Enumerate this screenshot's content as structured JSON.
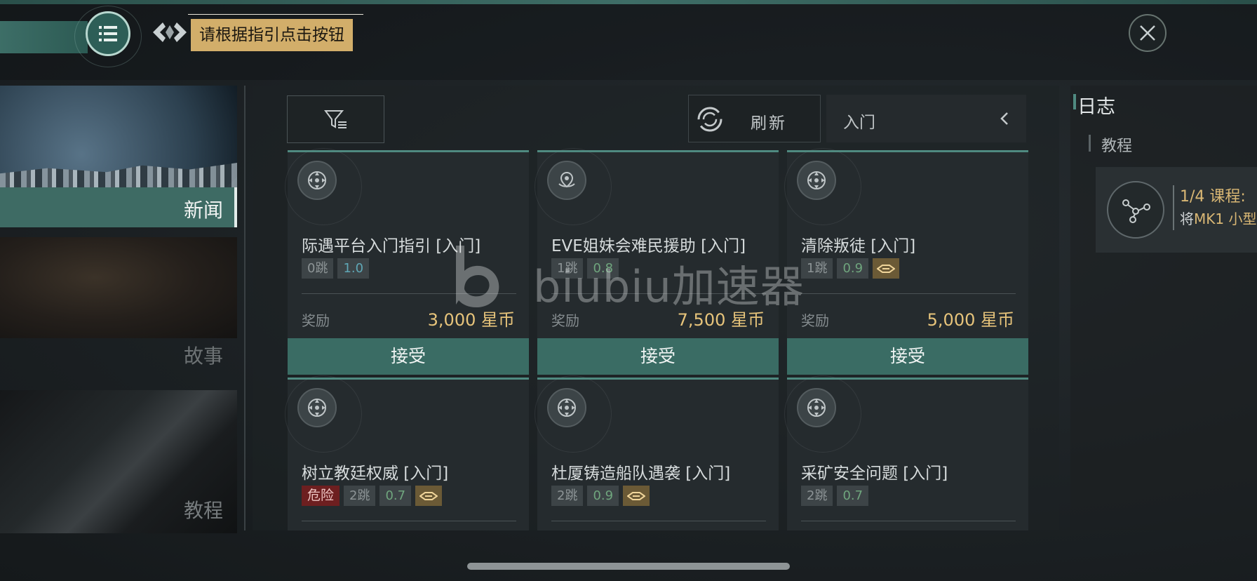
{
  "header": {
    "tooltip": "请根据指引点击按钮",
    "menu_icon": "hamburger-menu-icon",
    "logo_icon": "eve-logo-icon",
    "close_icon": "close-x-icon"
  },
  "sidebar": {
    "items": [
      {
        "label": "新闻",
        "selected": true
      },
      {
        "label": "故事",
        "selected": false
      },
      {
        "label": "教程",
        "selected": false
      }
    ]
  },
  "toolbar": {
    "filter_icon": "filter-icon",
    "refresh_label": "刷新",
    "category_value": "入门"
  },
  "missions": [
    {
      "title": "际遇平台入门指引 [入门]",
      "icon": "crosshair-target-icon",
      "jumps": "0跳",
      "security": "1.0",
      "reward_label": "奖励",
      "reward": "3,000 星币",
      "accept": "接受"
    },
    {
      "title": "EVE姐妹会难民援助 [入门]",
      "icon": "location-pin-icon",
      "jumps": "1跳",
      "security": "0.8",
      "reward_label": "奖励",
      "reward": "7,500 星币",
      "accept": "接受"
    },
    {
      "title": "清除叛徒 [入门]",
      "icon": "crosshair-target-icon",
      "jumps": "1跳",
      "security": "0.9",
      "ship_icon": "ship-class-icon",
      "reward_label": "奖励",
      "reward": "5,000 星币",
      "accept": "接受"
    },
    {
      "title": "树立教廷权威 [入门]",
      "icon": "crosshair-target-icon",
      "danger": "危险",
      "jumps": "2跳",
      "security": "0.7",
      "ship_icon": "ship-class-icon"
    },
    {
      "title": "杜厦铸造船队遇袭 [入门]",
      "icon": "crosshair-target-icon",
      "jumps": "2跳",
      "security": "0.9",
      "ship_icon": "ship-class-icon"
    },
    {
      "title": "采矿安全问题 [入门]",
      "icon": "crosshair-target-icon",
      "jumps": "2跳",
      "security": "0.7"
    }
  ],
  "log": {
    "title": "日志",
    "tab": "教程",
    "course_progress": "1/4 课程:",
    "course_desc_prefix": "将",
    "course_desc_highlight": "MK1 小型"
  },
  "watermark": "biubiu加速器",
  "colors": {
    "accent_teal": "#3e6b64",
    "reward_gold": "#e7c47b",
    "danger_red": "#6d1f20",
    "tooltip_gold": "#d2ae6a"
  }
}
